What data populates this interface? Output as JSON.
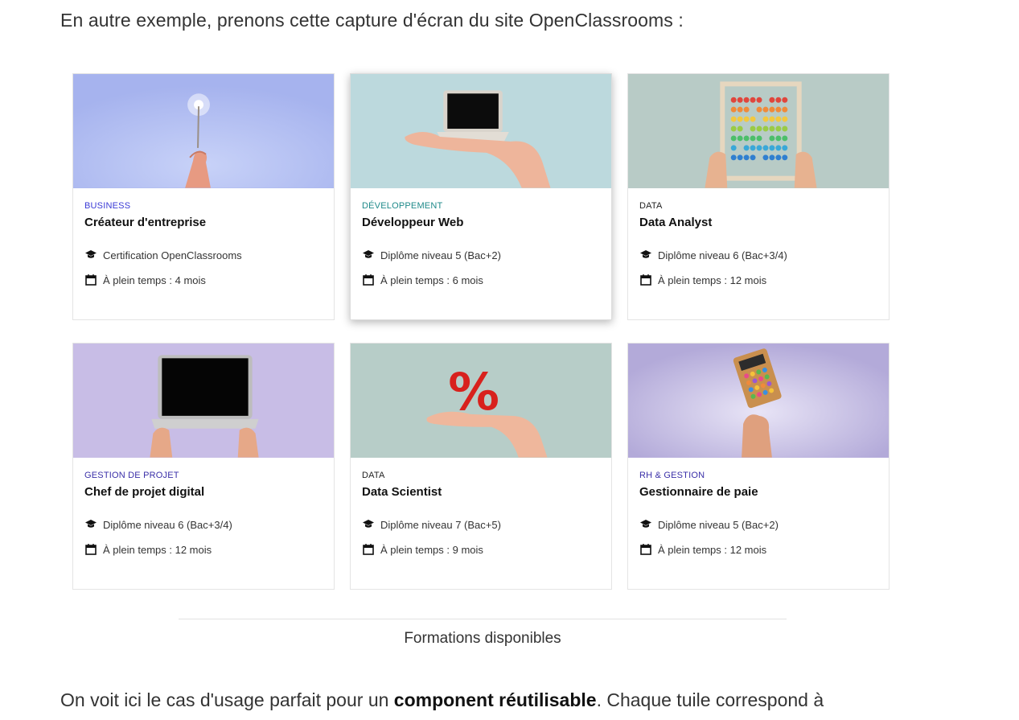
{
  "intro": "En autre exemple, prenons cette capture d'écran du site OpenClassrooms :",
  "cards": [
    {
      "category": "BUSINESS",
      "category_color": "#3a3ad6",
      "title": "Créateur d'entreprise",
      "credential": "Certification OpenClassrooms",
      "duration": "À plein temps : 4 mois",
      "bg": "#aab7ef",
      "art": "sparkler-hand"
    },
    {
      "category": "DÉVELOPPEMENT",
      "category_color": "#1f8a8a",
      "title": "Développeur Web",
      "credential": "Diplôme niveau 5 (Bac+2)",
      "duration": "À plein temps : 6 mois",
      "bg": "#bcd9dd",
      "art": "mini-laptop-hand"
    },
    {
      "category": "DATA",
      "category_color": "#222222",
      "title": "Data Analyst",
      "credential": "Diplôme niveau 6 (Bac+3/4)",
      "duration": "À plein temps : 12 mois",
      "bg": "#b8cbc6",
      "art": "abacus-hands"
    },
    {
      "category": "GESTION DE PROJET",
      "category_color": "#3a2fa8",
      "title": "Chef de projet digital",
      "credential": "Diplôme niveau 6 (Bac+3/4)",
      "duration": "À plein temps : 12 mois",
      "bg": "#c8bde6",
      "art": "laptop-hands"
    },
    {
      "category": "DATA",
      "category_color": "#222222",
      "title": "Data Scientist",
      "credential": "Diplôme niveau 7 (Bac+5)",
      "duration": "À plein temps : 9 mois",
      "bg": "#b7cdc8",
      "art": "percent-hand"
    },
    {
      "category": "RH & GESTION",
      "category_color": "#3a2fa8",
      "title": "Gestionnaire de paie",
      "credential": "Diplôme niveau 5 (Bac+2)",
      "duration": "À plein temps : 12 mois",
      "bg": "#b8b0df",
      "art": "calculator-hand"
    }
  ],
  "icons": {
    "credential": "graduation-cap-icon",
    "duration": "calendar-icon"
  },
  "caption": "Formations disponibles",
  "outro": {
    "before": "On voit ici le cas d'usage parfait pour un ",
    "bold": "component réutilisable",
    "after": ". Chaque tuile correspond à"
  }
}
